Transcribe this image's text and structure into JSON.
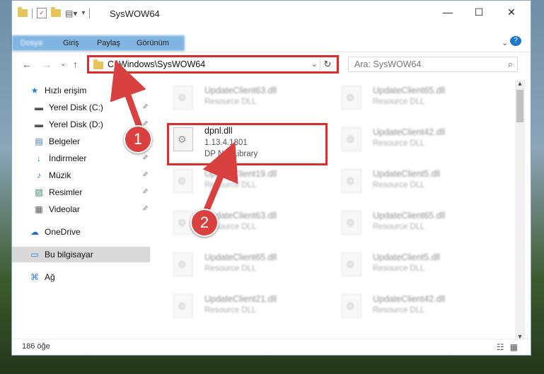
{
  "window": {
    "title": "SysWOW64",
    "minimize": "—",
    "maximize": "☐",
    "close": "✕"
  },
  "ribbon": {
    "tabs": [
      "Dosya",
      "Giriş",
      "Paylaş",
      "Görünüm"
    ],
    "collapse": "⌄",
    "help": "?"
  },
  "address": {
    "path": "C:\\Windows\\SysWOW64",
    "refresh": "↻",
    "dropdown": "⌄"
  },
  "search": {
    "placeholder": "Ara: SysWOW64",
    "icon": "⌕"
  },
  "nav": {
    "back": "←",
    "forward": "→",
    "recent": "⌄",
    "up": "↑"
  },
  "sidebar": {
    "items": [
      {
        "label": "Hızlı erişim",
        "icon": "star-icon",
        "glyph": "★",
        "color": "#2b7cd3"
      },
      {
        "label": "Yerel Disk (C:)",
        "icon": "drive-icon",
        "glyph": "▬",
        "color": "#555",
        "pinned": true
      },
      {
        "label": "Yerel Disk (D:)",
        "icon": "drive-icon",
        "glyph": "▬",
        "color": "#555",
        "pinned": true
      },
      {
        "label": "Belgeler",
        "icon": "documents-icon",
        "glyph": "▤",
        "color": "#4a6fa5",
        "pinned": true
      },
      {
        "label": "İndirmeler",
        "icon": "downloads-icon",
        "glyph": "↓",
        "color": "#2b7cd3",
        "pinned": true
      },
      {
        "label": "Müzik",
        "icon": "music-icon",
        "glyph": "♪",
        "color": "#2b7cd3",
        "pinned": true
      },
      {
        "label": "Resimler",
        "icon": "pictures-icon",
        "glyph": "▨",
        "color": "#3c8c6e",
        "pinned": true
      },
      {
        "label": "Videolar",
        "icon": "videos-icon",
        "glyph": "▦",
        "color": "#555",
        "pinned": true
      },
      {
        "label": "OneDrive",
        "icon": "onedrive-icon",
        "glyph": "☁",
        "color": "#1e6fc1"
      },
      {
        "label": "Bu bilgisayar",
        "icon": "computer-icon",
        "glyph": "▭",
        "color": "#2b7cd3"
      },
      {
        "label": "Ağ",
        "icon": "network-icon",
        "glyph": "⌘",
        "color": "#2b7cd3"
      }
    ],
    "pin_glyph": "📌"
  },
  "files": [
    {
      "name": "UpdateClient63.dll",
      "sub": "Resource DLL"
    },
    {
      "name": "UpdateClient65.dll",
      "sub": "Resource DLL"
    },
    {
      "name": "dpnl.dll",
      "sub": "1.13.4.1801",
      "sub2": "DP Net Library"
    },
    {
      "name": "UpdateClient42.dll",
      "sub": "Resource DLL"
    },
    {
      "name": "UpdateClient19.dll",
      "sub": "Resource DLL"
    },
    {
      "name": "UpdateClient5.dll",
      "sub": "Resource DLL"
    },
    {
      "name": "UpdateClient63.dll",
      "sub": "Resource DLL"
    },
    {
      "name": "UpdateClient65.dll",
      "sub": "Resource DLL"
    },
    {
      "name": "UpdateClient65.dll",
      "sub": "Resource DLL"
    },
    {
      "name": "UpdateClient5.dll",
      "sub": "Resource DLL"
    },
    {
      "name": "UpdateClient21.dll",
      "sub": "Resource DLL"
    },
    {
      "name": "UpdateClient42.dll",
      "sub": "Resource DLL"
    }
  ],
  "status": {
    "count": "186 öğe"
  },
  "annotations": {
    "step1": "1",
    "step2": "2",
    "highlight_color": "#e02b2b"
  }
}
